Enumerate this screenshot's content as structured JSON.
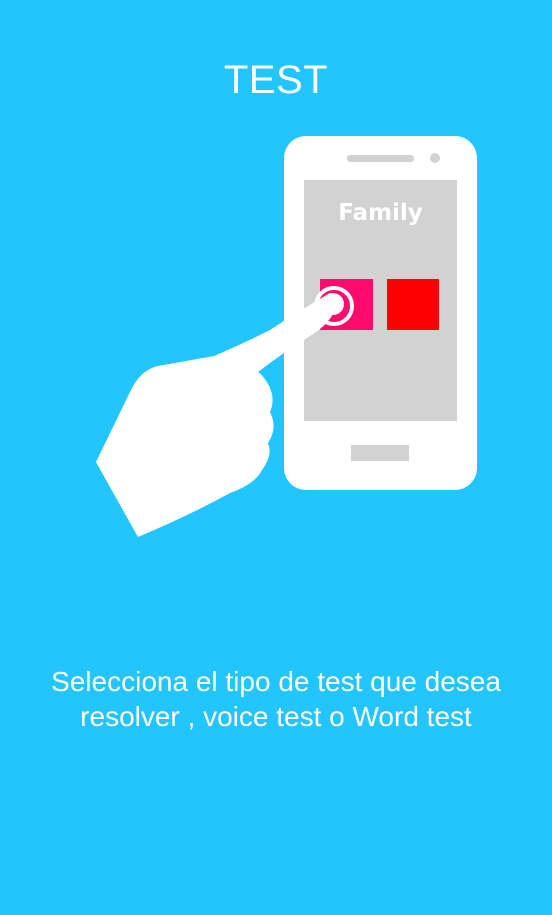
{
  "header": {
    "title": "TEST"
  },
  "illustration": {
    "phone_label": "Family",
    "colors": {
      "background": "#22c5fe",
      "phone_body": "#ffffff",
      "phone_screen": "#d3d2d3",
      "tile_left": "#ff0b6e",
      "tile_right": "#ff0000",
      "hand": "#ffffff"
    },
    "icon": "hand-tap-icon"
  },
  "instruction": {
    "text": "Selecciona el tipo de test que desea resolver , voice test o Word test"
  }
}
